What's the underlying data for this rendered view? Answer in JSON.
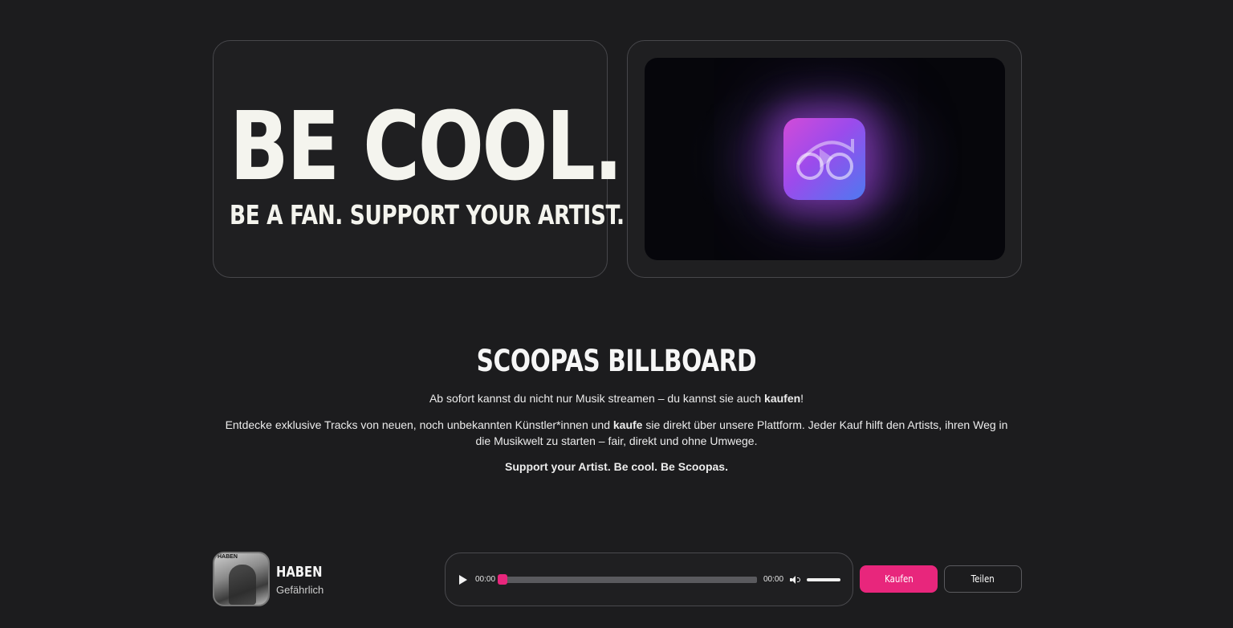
{
  "hero": {
    "headline": "BE COOL.",
    "subheadline": "BE A FAN. SUPPORT YOUR ARTIST."
  },
  "billboard": {
    "title": "SCOOPAS BILLBOARD",
    "p1_text": "Ab sofort kannst du nicht nur Musik streamen – du kannst sie auch ",
    "p1_bold": "kaufen",
    "p1_end": "!",
    "p2_text_a": "Entdecke exklusive Tracks von neuen, noch unbekannten Künstler*innen und ",
    "p2_bold": "kaufe",
    "p2_text_b": " sie direkt über unsere Plattform. Jeder Kauf hilft den Artists, ihren Weg in die Musikwelt zu starten – fair, direkt und ohne Umwege.",
    "p3": "Support your Artist. Be cool. Be Scoopas."
  },
  "track": {
    "cover_label": "HABEN",
    "title": "HABEN",
    "artist": "Gefährlich"
  },
  "player": {
    "current_time": "00:00",
    "total_time": "00:00",
    "progress": 0,
    "volume": 1
  },
  "actions": {
    "buy_label": "Kaufen",
    "share_label": "Teilen"
  },
  "colors": {
    "accent": "#e8267c",
    "background": "#1c1c1e"
  },
  "icons": [
    "play-icon",
    "volume-icon",
    "app-logo-icon"
  ]
}
